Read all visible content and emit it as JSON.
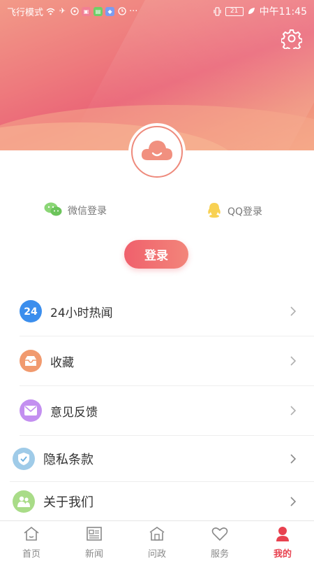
{
  "status_bar": {
    "mode": "飞行模式",
    "time": "中午11:45",
    "battery": "21",
    "more": "···"
  },
  "header": {
    "settings_icon": "gear-icon",
    "avatar_icon": "cloud-smile-icon"
  },
  "login": {
    "wechat_label": "微信登录",
    "qq_label": "QQ登录",
    "button_label": "登录"
  },
  "menu": {
    "items": [
      {
        "label": "24小时热闻",
        "icon": "24-hours-icon"
      },
      {
        "label": "收藏",
        "icon": "inbox-icon"
      },
      {
        "label": "意见反馈",
        "icon": "mail-icon"
      },
      {
        "label": "隐私条款",
        "icon": "shield-check-icon"
      },
      {
        "label": "关于我们",
        "icon": "people-icon"
      }
    ]
  },
  "tabbar": {
    "tabs": [
      {
        "label": "首页",
        "icon": "home-icon"
      },
      {
        "label": "新闻",
        "icon": "news-icon"
      },
      {
        "label": "问政",
        "icon": "building-icon"
      },
      {
        "label": "服务",
        "icon": "heart-icon"
      },
      {
        "label": "我的",
        "icon": "user-icon",
        "active": true
      }
    ]
  },
  "colors": {
    "accent": "#e8414f",
    "header_gradient_start": "#f29a88",
    "header_gradient_mid": "#ea6677",
    "wechat": "#7dd36a",
    "qq": "#f9d25a"
  }
}
